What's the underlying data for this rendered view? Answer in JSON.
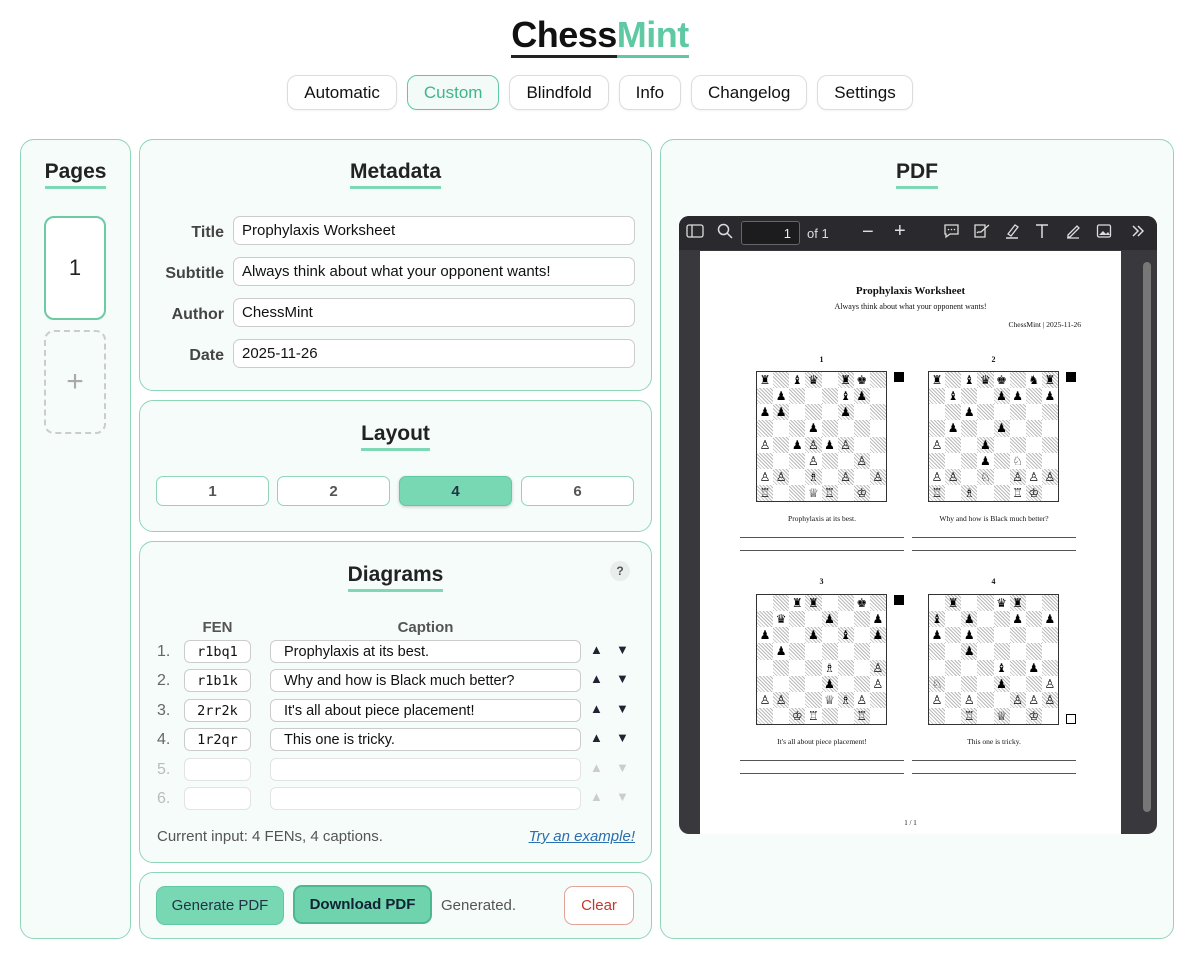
{
  "logo": {
    "part1": "Chess",
    "part2": "Mint"
  },
  "nav": [
    "Automatic",
    "Custom",
    "Blindfold",
    "Info",
    "Changelog",
    "Settings"
  ],
  "pages": {
    "title": "Pages",
    "items": [
      "1"
    ],
    "add": "+"
  },
  "metadata": {
    "title": "Metadata",
    "fields": [
      {
        "label": "Title",
        "value": "Prophylaxis Worksheet"
      },
      {
        "label": "Subtitle",
        "value": "Always think about what your opponent wants!"
      },
      {
        "label": "Author",
        "value": "ChessMint"
      },
      {
        "label": "Date",
        "value": "2025-11-26"
      }
    ]
  },
  "layout": {
    "title": "Layout",
    "options": [
      "1",
      "2",
      "4",
      "6"
    ],
    "selected": "4"
  },
  "diagrams": {
    "title": "Diagrams",
    "help": "?",
    "fen_header": "FEN",
    "caption_header": "Caption",
    "rows": [
      {
        "num": "1.",
        "fen": "r1bq1",
        "caption": "Prophylaxis at its best."
      },
      {
        "num": "2.",
        "fen": "r1b1k",
        "caption": "Why and how is Black much better?"
      },
      {
        "num": "3.",
        "fen": "2rr2k",
        "caption": "It's all about piece placement!"
      },
      {
        "num": "4.",
        "fen": "1r2qr",
        "caption": "This one is tricky."
      },
      {
        "num": "5.",
        "fen": "",
        "caption": ""
      },
      {
        "num": "6.",
        "fen": "",
        "caption": ""
      }
    ],
    "status": "Current input: 4 FENs, 4 captions.",
    "example_link": "Try an example!"
  },
  "actions": {
    "generate": "Generate PDF",
    "download": "Download PDF",
    "status": "Generated.",
    "clear": "Clear"
  },
  "pdf": {
    "title": "PDF",
    "toolbar": {
      "page": "1",
      "of": "of 1"
    },
    "doc": {
      "title": "Prophylaxis Worksheet",
      "subtitle": "Always think about what your opponent wants!",
      "byline": "ChessMint | 2025-11-26",
      "footer": "1 / 1",
      "diagrams": [
        {
          "num": "1",
          "caption": "Prophylaxis at its best.",
          "to_move": "black"
        },
        {
          "num": "2",
          "caption": "Why and how is Black much better?",
          "to_move": "black"
        },
        {
          "num": "3",
          "caption": "It's all about piece placement!",
          "to_move": "black"
        },
        {
          "num": "4",
          "caption": "This one is tricky.",
          "to_move": "white"
        }
      ]
    }
  },
  "colors": {
    "accent": "#5fc9a4",
    "panel_bg": "#f6fcfa",
    "border": "#8fd6b9",
    "clear_red": "#c0392b"
  }
}
